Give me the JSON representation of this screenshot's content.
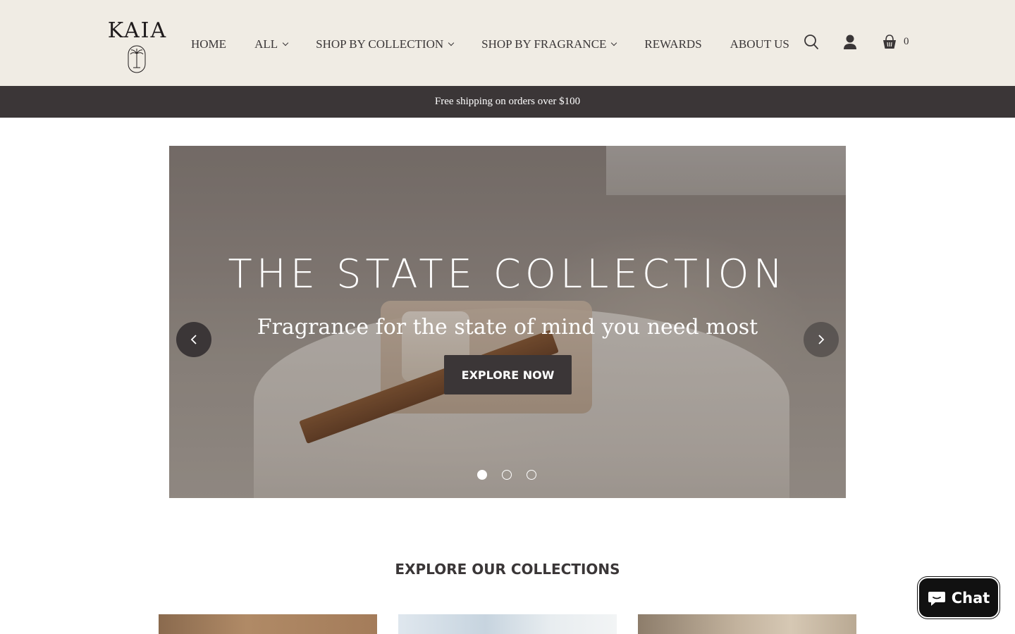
{
  "brand": {
    "name": "KAIA"
  },
  "nav": {
    "items": [
      {
        "label": "HOME",
        "dropdown": false
      },
      {
        "label": "ALL",
        "dropdown": true
      },
      {
        "label": "SHOP BY COLLECTION",
        "dropdown": true
      },
      {
        "label": "SHOP BY FRAGRANCE",
        "dropdown": true
      },
      {
        "label": "REWARDS",
        "dropdown": false
      },
      {
        "label": "ABOUT US",
        "dropdown": false
      }
    ],
    "icons": [
      "search-icon",
      "account-icon",
      "cart-icon"
    ],
    "cart_count": "0"
  },
  "announcement": {
    "text": "Free shipping on orders over $100"
  },
  "hero": {
    "title": "THE STATE COLLECTION",
    "subtitle": "Fragrance for the state of mind you need most",
    "cta": "EXPLORE NOW",
    "slides": 3,
    "active_slide": 1
  },
  "collections": {
    "title": "EXPLORE OUR COLLECTIONS",
    "cards": 3
  },
  "chat": {
    "label": "Chat"
  },
  "colors": {
    "header_bg": "#f0ece4",
    "announce_bg": "#3b3637",
    "text": "#3a3637",
    "chat_bg": "#111111"
  }
}
